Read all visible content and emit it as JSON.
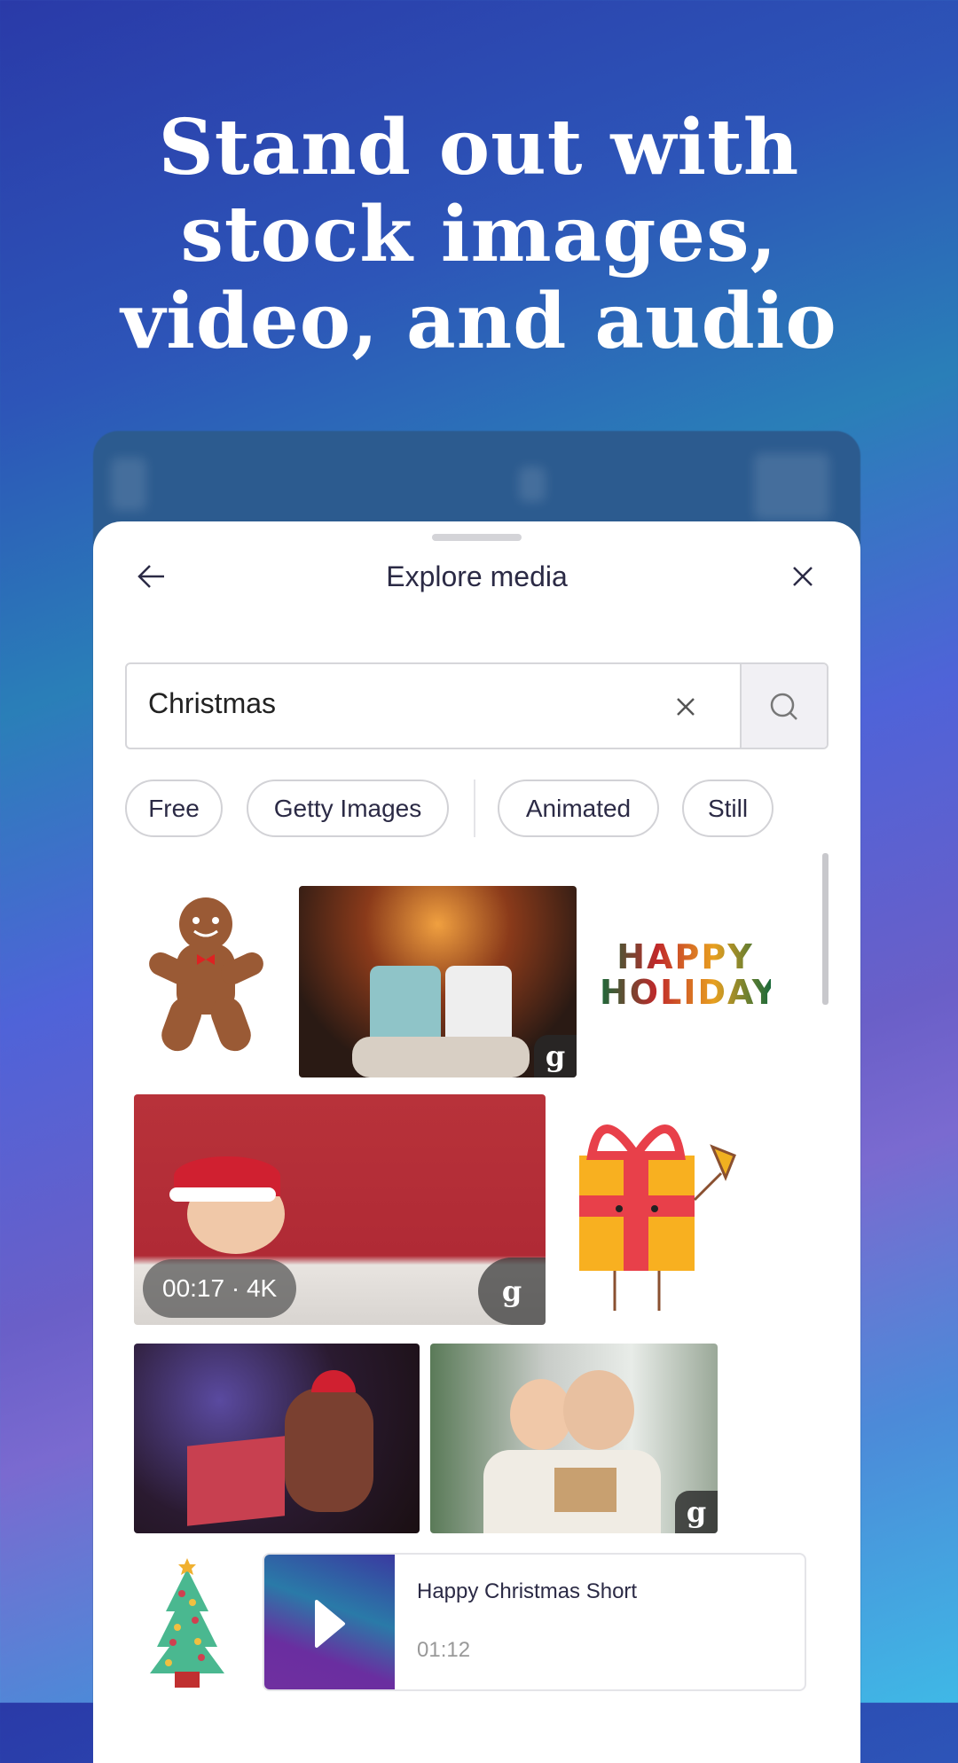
{
  "headline": {
    "line1": "Stand out with",
    "line2": "stock images,",
    "line3": "video, and audio"
  },
  "sheet": {
    "title": "Explore media",
    "back_icon": "arrow-left-icon",
    "close_icon": "close-icon"
  },
  "search": {
    "value": "Christmas",
    "clear_icon": "close-icon",
    "search_icon": "search-icon"
  },
  "filters": [
    {
      "label": "Free"
    },
    {
      "label": "Getty Images"
    },
    {
      "label": "Animated"
    },
    {
      "label": "Still"
    }
  ],
  "results": {
    "items": [
      {
        "type": "sticker",
        "subject": "gingerbread man"
      },
      {
        "type": "photo",
        "subject": "snowman mugs with marshmallows",
        "badge": "g"
      },
      {
        "type": "sticker",
        "text": "HAPPY HOLIDAYS"
      },
      {
        "type": "video",
        "subject": "child in santa hat",
        "duration": "00:17 · 4K",
        "badge": "g"
      },
      {
        "type": "sticker",
        "subject": "gift box with bell"
      },
      {
        "type": "photo",
        "subject": "child opening present"
      },
      {
        "type": "photo",
        "subject": "grandmother and child with gift",
        "badge": "g"
      },
      {
        "type": "sticker",
        "subject": "christmas tree"
      }
    ],
    "audio": {
      "title": "Happy Christmas Short",
      "duration": "01:12",
      "play_icon": "play-icon"
    }
  }
}
